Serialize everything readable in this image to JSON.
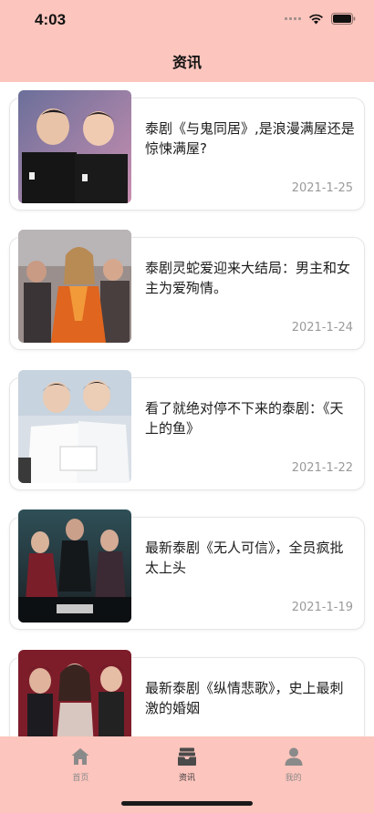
{
  "status": {
    "time": "4:03"
  },
  "header": {
    "title": "资讯"
  },
  "articles": [
    {
      "title": "泰剧《与鬼同居》,是浪漫满屋还是惊悚满屋?",
      "date": "2021-1-25"
    },
    {
      "title": "泰剧灵蛇爱迎来大结局：男主和女主为爱殉情。",
      "date": "2021-1-24"
    },
    {
      "title": "看了就绝对停不下来的泰剧：《天上的鱼》",
      "date": "2021-1-22"
    },
    {
      "title": "最新泰剧《无人可信》，全员疯批太上头",
      "date": "2021-1-19"
    },
    {
      "title": "最新泰剧《纵情悲歌》，史上最刺激的婚姻",
      "date": ""
    }
  ],
  "tabs": [
    {
      "label": "首页",
      "icon": "home-icon"
    },
    {
      "label": "资讯",
      "icon": "news-icon"
    },
    {
      "label": "我的",
      "icon": "profile-icon"
    }
  ],
  "colors": {
    "accent_bg": "#fcc5bd",
    "tab_active": "#4a4a4a",
    "tab_inactive": "#8a8a8a"
  }
}
